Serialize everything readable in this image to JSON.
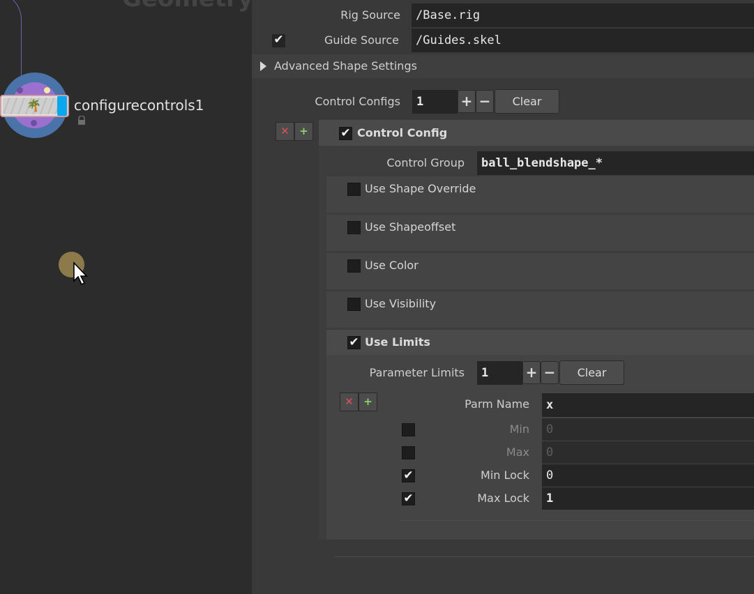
{
  "network": {
    "title": "Geometry",
    "node_label": "configurecontrols1",
    "node_icon": "figure-icon",
    "lock_icon": "lock-icon"
  },
  "params": {
    "rig_source": {
      "label": "Rig Source",
      "value": "/Base.rig"
    },
    "guide_source": {
      "label": "Guide Source",
      "value": "/Guides.skel",
      "enabled": true
    },
    "advanced_shape_settings": {
      "label": "Advanced Shape Settings",
      "expanded": false
    },
    "control_configs": {
      "label": "Control Configs",
      "value": "1",
      "plus": "+",
      "minus": "−",
      "clear": "Clear"
    },
    "control_config": {
      "header": "Control Config",
      "enabled": true,
      "remove_icon": "✕",
      "insert_icon": "+",
      "control_group": {
        "label": "Control Group",
        "value": "ball_blendshape_*"
      },
      "use_shape_override": {
        "label": "Use Shape Override",
        "checked": false
      },
      "use_shapeoffset": {
        "label": "Use Shapeoffset",
        "checked": false
      },
      "use_color": {
        "label": "Use Color",
        "checked": false
      },
      "use_visibility": {
        "label": "Use Visibility",
        "checked": false
      },
      "use_limits": {
        "label": "Use Limits",
        "checked": true,
        "parameter_limits": {
          "label": "Parameter Limits",
          "value": "1",
          "plus": "+",
          "minus": "−",
          "clear": "Clear"
        },
        "entry": {
          "remove_icon": "✕",
          "insert_icon": "+",
          "parm_name": {
            "label": "Parm Name",
            "value": "x"
          },
          "min": {
            "label": "Min",
            "value": "0",
            "checked": false
          },
          "max": {
            "label": "Max",
            "value": "0",
            "checked": false
          },
          "min_lock": {
            "label": "Min Lock",
            "value": "0",
            "checked": true
          },
          "max_lock": {
            "label": "Max Lock",
            "value": "1",
            "checked": true
          }
        }
      }
    }
  },
  "check_glyph": "✔",
  "colors": {
    "accent_flag": "#0aa6ee",
    "node_ring": "#4a74a9",
    "node_inner": "#9c70cf"
  }
}
